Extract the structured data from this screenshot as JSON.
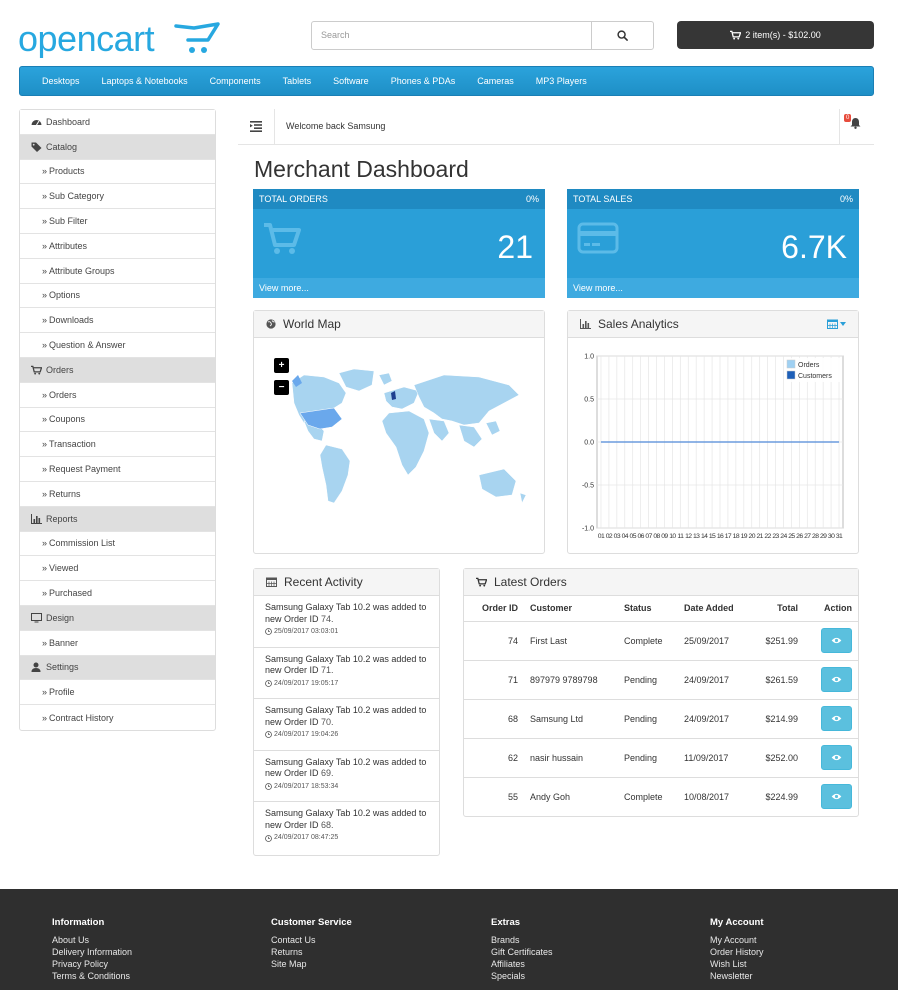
{
  "header": {
    "logo_text": "opencart",
    "search_placeholder": "Search",
    "cart_label": "2 item(s) - $102.00"
  },
  "topnav": [
    "Desktops",
    "Laptops & Notebooks",
    "Components",
    "Tablets",
    "Software",
    "Phones & PDAs",
    "Cameras",
    "MP3 Players"
  ],
  "sidebar": [
    {
      "type": "head",
      "icon": "dashboard-icon",
      "label": "Dashboard",
      "first": true
    },
    {
      "type": "head",
      "icon": "tag-icon",
      "label": "Catalog"
    },
    {
      "type": "sub",
      "label": "Products"
    },
    {
      "type": "sub",
      "label": "Sub Category"
    },
    {
      "type": "sub",
      "label": "Sub Filter"
    },
    {
      "type": "sub",
      "label": "Attributes"
    },
    {
      "type": "sub",
      "label": "Attribute Groups"
    },
    {
      "type": "sub",
      "label": "Options"
    },
    {
      "type": "sub",
      "label": "Downloads"
    },
    {
      "type": "sub",
      "label": "Question & Answer"
    },
    {
      "type": "head",
      "icon": "cart-icon",
      "label": "Orders"
    },
    {
      "type": "sub",
      "label": "Orders"
    },
    {
      "type": "sub",
      "label": "Coupons"
    },
    {
      "type": "sub",
      "label": "Transaction"
    },
    {
      "type": "sub",
      "label": "Request Payment"
    },
    {
      "type": "sub",
      "label": "Returns"
    },
    {
      "type": "head",
      "icon": "bar-chart-icon",
      "label": "Reports"
    },
    {
      "type": "sub",
      "label": "Commission List"
    },
    {
      "type": "sub",
      "label": "Viewed"
    },
    {
      "type": "sub",
      "label": "Purchased"
    },
    {
      "type": "head",
      "icon": "monitor-icon",
      "label": "Design"
    },
    {
      "type": "sub",
      "label": "Banner"
    },
    {
      "type": "head",
      "icon": "user-icon",
      "label": "Settings"
    },
    {
      "type": "sub",
      "label": "Profile"
    },
    {
      "type": "sub",
      "label": "Contract History"
    }
  ],
  "welcome": {
    "text": "Welcome back Samsung",
    "notification_count": "0"
  },
  "page_title": "Merchant Dashboard",
  "tiles": {
    "orders": {
      "title": "TOTAL ORDERS",
      "percent": "0%",
      "value": "21",
      "link": "View more..."
    },
    "sales": {
      "title": "TOTAL SALES",
      "percent": "0%",
      "value": "6.7K",
      "link": "View more..."
    }
  },
  "world_map": {
    "title": "World Map",
    "zoom_in": "+",
    "zoom_out": "−"
  },
  "sales_analytics": {
    "title": "Sales Analytics",
    "chart_data": {
      "type": "line",
      "x": [
        1,
        2,
        3,
        4,
        5,
        6,
        7,
        8,
        9,
        10,
        11,
        12,
        13,
        14,
        15,
        16,
        17,
        18,
        19,
        20,
        21,
        22,
        23,
        24,
        25,
        26,
        27,
        28,
        29,
        30,
        31
      ],
      "x_tick_labels": [
        "01",
        "02",
        "03",
        "04",
        "05",
        "06",
        "07",
        "08",
        "09",
        "10",
        "11",
        "12",
        "13",
        "14",
        "15",
        "16",
        "17",
        "18",
        "19",
        "20",
        "21",
        "22",
        "23",
        "24",
        "25",
        "26",
        "27",
        "28",
        "29",
        "30",
        "31"
      ],
      "y_tick_labels": [
        "1.0",
        "0.5",
        "0.0",
        "-0.5",
        "-1.0"
      ],
      "ylim": [
        -1,
        1
      ],
      "grid": true,
      "legend_position": "top-right",
      "series": [
        {
          "name": "Orders",
          "color": "#9fd0f2",
          "values": [
            0,
            0,
            0,
            0,
            0,
            0,
            0,
            0,
            0,
            0,
            0,
            0,
            0,
            0,
            0,
            0,
            0,
            0,
            0,
            0,
            0,
            0,
            0,
            0,
            0,
            0,
            0,
            0,
            0,
            0,
            0
          ]
        },
        {
          "name": "Customers",
          "color": "#1d5fb8",
          "values": [
            0,
            0,
            0,
            0,
            0,
            0,
            0,
            0,
            0,
            0,
            0,
            0,
            0,
            0,
            0,
            0,
            0,
            0,
            0,
            0,
            0,
            0,
            0,
            0,
            0,
            0,
            0,
            0,
            0,
            0,
            0
          ]
        }
      ]
    }
  },
  "recent_activity": {
    "title": "Recent Activity",
    "items": [
      {
        "text": "Samsung Galaxy Tab 10.2 was added to new Order ID",
        "order_id": "74.",
        "date": "25/09/2017 03:03:01"
      },
      {
        "text": "Samsung Galaxy Tab 10.2 was added to new Order ID",
        "order_id": "71.",
        "date": "24/09/2017 19:05:17"
      },
      {
        "text": "Samsung Galaxy Tab 10.2 was added to new Order ID",
        "order_id": "70.",
        "date": "24/09/2017 19:04:26"
      },
      {
        "text": "Samsung Galaxy Tab 10.2 was added to new Order ID",
        "order_id": "69.",
        "date": "24/09/2017 18:53:34"
      },
      {
        "text": "Samsung Galaxy Tab 10.2 was added to new Order ID",
        "order_id": "68.",
        "date": "24/09/2017 08:47:25"
      }
    ]
  },
  "latest_orders": {
    "title": "Latest Orders",
    "columns": [
      "Order ID",
      "Customer",
      "Status",
      "Date Added",
      "Total",
      "Action"
    ],
    "rows": [
      {
        "id": "74",
        "customer": "First Last",
        "status": "Complete",
        "date": "25/09/2017",
        "total": "$251.99"
      },
      {
        "id": "71",
        "customer": "897979 9789798",
        "status": "Pending",
        "date": "24/09/2017",
        "total": "$261.59"
      },
      {
        "id": "68",
        "customer": "Samsung Ltd",
        "status": "Pending",
        "date": "24/09/2017",
        "total": "$214.99"
      },
      {
        "id": "62",
        "customer": "nasir hussain",
        "status": "Pending",
        "date": "11/09/2017",
        "total": "$252.00"
      },
      {
        "id": "55",
        "customer": "Andy Goh",
        "status": "Complete",
        "date": "10/08/2017",
        "total": "$224.99"
      }
    ]
  },
  "footer": [
    {
      "heading": "Information",
      "links": [
        "About Us",
        "Delivery Information",
        "Privacy Policy",
        "Terms & Conditions"
      ]
    },
    {
      "heading": "Customer Service",
      "links": [
        "Contact Us",
        "Returns",
        "Site Map"
      ]
    },
    {
      "heading": "Extras",
      "links": [
        "Brands",
        "Gift Certificates",
        "Affiliates",
        "Specials"
      ]
    },
    {
      "heading": "My Account",
      "links": [
        "My Account",
        "Order History",
        "Wish List",
        "Newsletter"
      ]
    }
  ],
  "colors": {
    "accent": "#2a9fd8",
    "nav": "#1e8fc6",
    "cart_bg": "#363636",
    "footer_bg": "#2f2f2f",
    "view_btn": "#5bc0de"
  }
}
